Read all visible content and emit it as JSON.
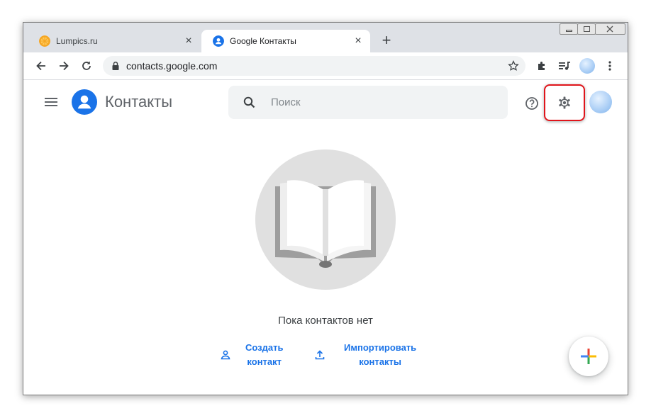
{
  "browser": {
    "tabs": [
      {
        "title": "Lumpics.ru",
        "active": false,
        "favicon": "orange-slice-icon"
      },
      {
        "title": "Google Контакты",
        "active": true,
        "favicon": "contacts-person-icon"
      }
    ],
    "new_tab_symbol": "+",
    "close_symbol": "×",
    "url": "contacts.google.com"
  },
  "app": {
    "title": "Контакты",
    "search_placeholder": "Поиск",
    "empty_state": {
      "message": "Пока контактов нет",
      "actions": [
        {
          "label_line1": "Создать",
          "label_line2": "контакт",
          "icon": "person-add-icon"
        },
        {
          "label_line1": "Импортировать",
          "label_line2": "контакты",
          "icon": "upload-icon"
        }
      ]
    }
  },
  "colors": {
    "accent": "#1a73e8",
    "highlight": "#e0151b",
    "tabbar": "#dee1e6"
  }
}
